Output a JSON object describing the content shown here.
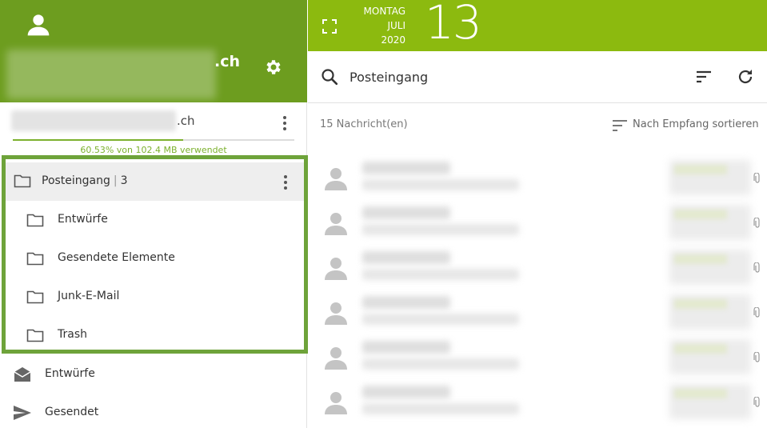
{
  "account": {
    "name_suffix": ".ch",
    "email_suffix": ".ch",
    "quota_text": "60.53% von 102.4 MB verwendet",
    "quota_percent": 60.53
  },
  "folders": {
    "inbox": {
      "label": "Posteingang",
      "separator": "|",
      "count": "3"
    },
    "subfolders": [
      {
        "label": "Entwürfe"
      },
      {
        "label": "Gesendete Elemente"
      },
      {
        "label": "Junk-E-Mail"
      },
      {
        "label": "Trash"
      }
    ]
  },
  "nav": [
    {
      "label": "Entwürfe",
      "icon": "envelope-open-icon"
    },
    {
      "label": "Gesendet",
      "icon": "send-icon"
    }
  ],
  "date": {
    "weekday": "MONTAG",
    "month": "JULI",
    "year": "2020",
    "day": "13"
  },
  "search": {
    "value": "Posteingang"
  },
  "list": {
    "count_text": "15 Nachricht(en)",
    "sort_label": "Nach Empfang sortieren"
  },
  "colors": {
    "sidebar_header": "#6d9d1f",
    "topbar": "#8cba0f",
    "highlight_border": "#6ea33a",
    "quota": "#7cb12e"
  }
}
